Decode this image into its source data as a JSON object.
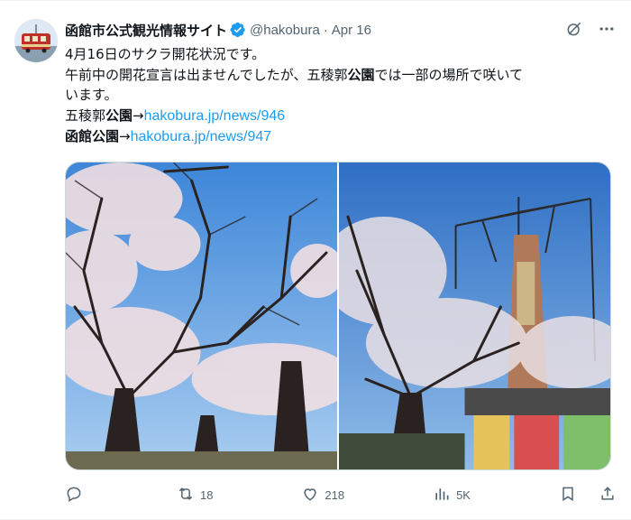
{
  "author": {
    "display_name": "函館市公式観光情報サイト",
    "handle": "@hakobura",
    "date": "Apr 16"
  },
  "body": {
    "line1": "4月16日のサクラ開花状況です。",
    "line2_a": "午前中の開花宣言は出ませんでしたが、五稜郭",
    "line2_bold": "公園",
    "line2_b": "では一部の場所で咲いて",
    "line3": "います。",
    "line4_prefix": "五稜郭",
    "line4_bold": "公園",
    "line4_arrow": "→",
    "line4_link": "hakobura.jp/news/946",
    "line5_bold": "函館公園",
    "line5_arrow": "→",
    "line5_link": "hakobura.jp/news/947"
  },
  "stats": {
    "replies": "",
    "retweets": "18",
    "likes": "218",
    "views": "5K"
  },
  "icons": {
    "verified": "verified-badge-icon",
    "grok": "grok-icon",
    "more": "more-icon",
    "reply": "reply-icon",
    "retweet": "retweet-icon",
    "like": "heart-icon",
    "views": "views-icon",
    "bookmark": "bookmark-icon",
    "share": "share-icon"
  },
  "colors": {
    "accent": "#1d9bf0",
    "text": "#0f1419",
    "secondary": "#536471"
  }
}
